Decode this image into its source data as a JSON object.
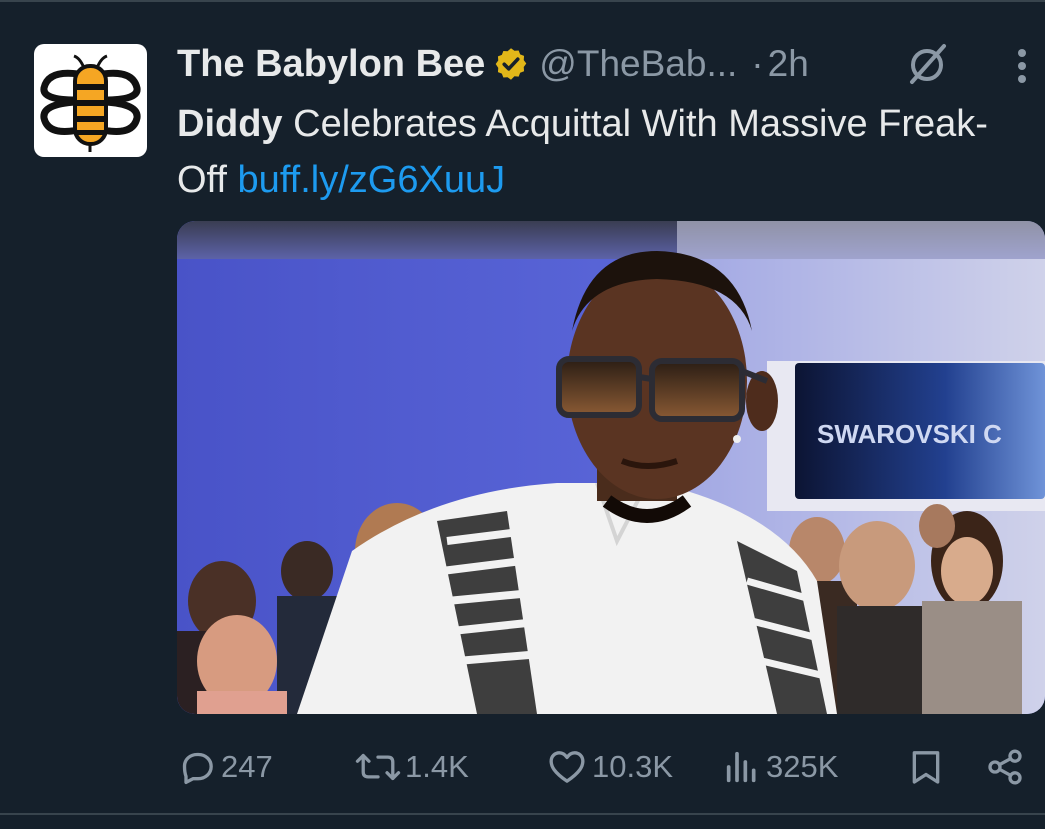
{
  "tweet": {
    "author_name": "The Babylon Bee",
    "handle": "@TheBab...",
    "separator": "·",
    "time": "2h",
    "text_bold": "Diddy",
    "text_rest": " Celebrates Acquittal With Massive Freak-Off ",
    "link": "buff.ly/zG6XuuJ",
    "media_sign_text": "SWAROVSKI C"
  },
  "actions": {
    "replies": "247",
    "reposts": "1.4K",
    "likes": "10.3K",
    "views": "325K"
  },
  "icons": {
    "avatar": "babylon-bee-logo",
    "verified": "gold-verified-badge",
    "grok": "grok-icon",
    "more": "more-vertical-icon",
    "reply": "reply-icon",
    "repost": "repost-icon",
    "like": "heart-icon",
    "views": "views-icon",
    "bookmark": "bookmark-icon",
    "share": "share-icon"
  },
  "colors": {
    "background": "#15202b",
    "text": "#e7e9ea",
    "muted": "#8b98a5",
    "link": "#1d9bf0",
    "verified": "#e2b719"
  }
}
